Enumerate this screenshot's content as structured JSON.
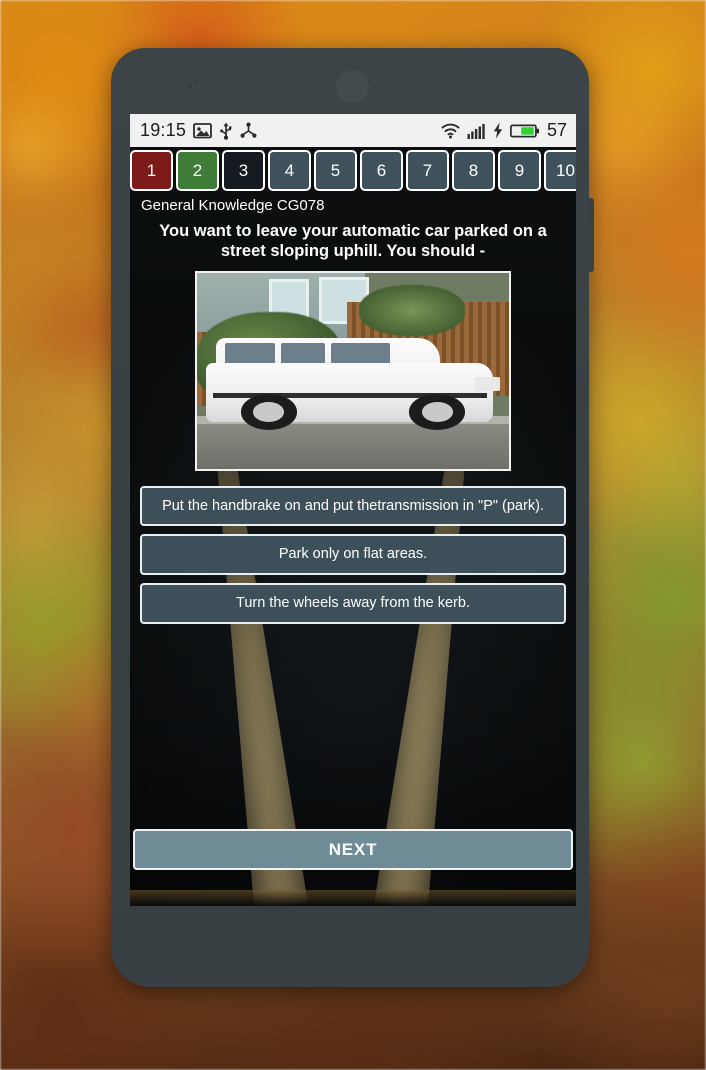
{
  "device": {
    "frame_color": "#394143",
    "sensor_icon": "proximity-sensor-icon",
    "earpiece_icon": "earpiece-speaker-icon",
    "side_button_icon": "power-button-icon"
  },
  "status_bar": {
    "time": "19:15",
    "left_icons": [
      "image-icon",
      "usb-icon",
      "share-icon"
    ],
    "right_icons": [
      "wifi-icon",
      "signal-icon",
      "charging-bolt-icon",
      "battery-icon"
    ],
    "battery_percent": "57",
    "battery_color": "#31d231",
    "background": "#f1f1f1"
  },
  "tabs": [
    {
      "label": "1",
      "state": "wrong"
    },
    {
      "label": "2",
      "state": "correct"
    },
    {
      "label": "3",
      "state": "current"
    },
    {
      "label": "4",
      "state": "pending"
    },
    {
      "label": "5",
      "state": "pending"
    },
    {
      "label": "6",
      "state": "pending"
    },
    {
      "label": "7",
      "state": "pending"
    },
    {
      "label": "8",
      "state": "pending"
    },
    {
      "label": "9",
      "state": "pending"
    },
    {
      "label": "10",
      "state": "pending"
    }
  ],
  "tab_colors": {
    "wrong": "#7d1a1a",
    "correct": "#3f7c38",
    "current": "#141a20",
    "pending": "#3f525c"
  },
  "quiz": {
    "category": "General Knowledge CG078",
    "question": "You want to leave your automatic car parked on a street sloping uphill. You should -",
    "image_alt": "white-station-wagon-parked-at-kerb-photo",
    "answers": [
      "Put the handbrake on and put thetransmission in \"P\" (park).",
      "Park only on flat areas.",
      "Turn the wheels away from the kerb."
    ],
    "next_label": "NEXT"
  },
  "theme": {
    "answer_button_bg": "#3d4f58",
    "next_button_bg": "#6f8b95",
    "text_color": "#ffffff",
    "screen_bg": "#151a1d"
  }
}
